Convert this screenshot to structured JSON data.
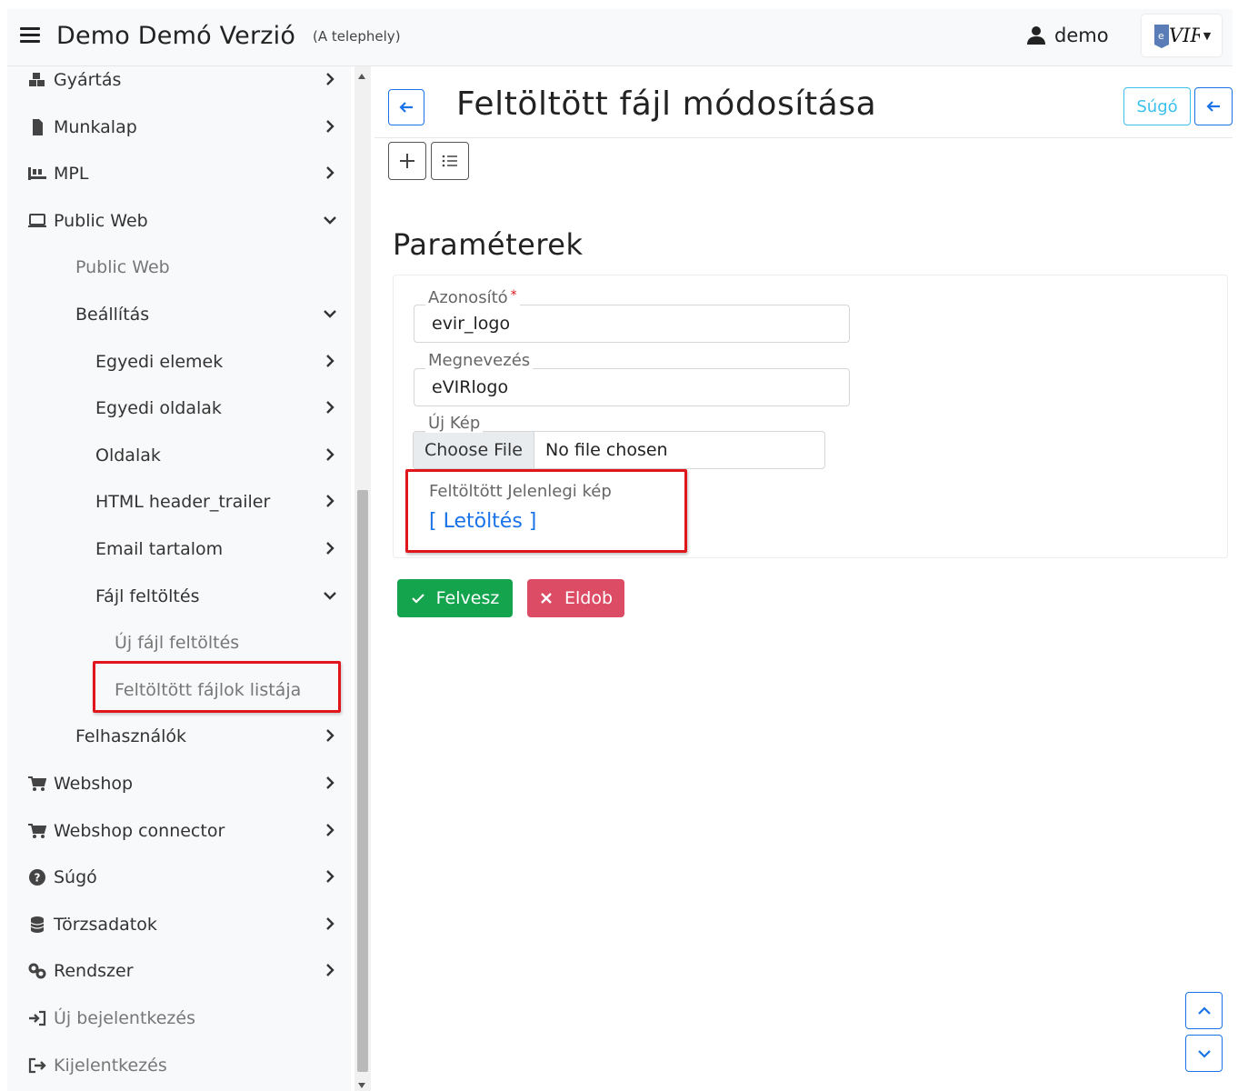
{
  "header": {
    "app_title": "Demo Demó Verzió",
    "site": "(A telephely)",
    "user": "demo",
    "logo_text": "VIR"
  },
  "sidebar": {
    "items": [
      {
        "label": "Gyártás",
        "icon": "cubes-icon",
        "expanded": false
      },
      {
        "label": "Munkalap",
        "icon": "file-icon",
        "expanded": false
      },
      {
        "label": "MPL",
        "icon": "pallet-icon",
        "expanded": false
      },
      {
        "label": "Public Web",
        "icon": "laptop-icon",
        "expanded": true
      },
      {
        "label": "Public Web"
      },
      {
        "label": "Beállítás",
        "expanded": true
      },
      {
        "label": "Egyedi elemek",
        "expanded": false
      },
      {
        "label": "Egyedi oldalak",
        "expanded": false
      },
      {
        "label": "Oldalak",
        "expanded": false
      },
      {
        "label": "HTML header_trailer",
        "expanded": false
      },
      {
        "label": "Email tartalom",
        "expanded": false
      },
      {
        "label": "Fájl feltöltés",
        "expanded": true
      },
      {
        "label": "Új fájl feltöltés"
      },
      {
        "label": "Feltöltött fájlok listája",
        "active": true
      },
      {
        "label": "Felhasználók",
        "expanded": false
      },
      {
        "label": "Webshop",
        "icon": "cart-icon",
        "expanded": false
      },
      {
        "label": "Webshop connector",
        "icon": "cart-icon",
        "expanded": false
      },
      {
        "label": "Súgó",
        "icon": "question-icon",
        "expanded": false
      },
      {
        "label": "Törzsadatok",
        "icon": "database-icon",
        "expanded": false
      },
      {
        "label": "Rendszer",
        "icon": "cogs-icon",
        "expanded": false
      },
      {
        "label": "Új bejelentkezés",
        "icon": "sign-in-icon"
      },
      {
        "label": "Kijelentkezés",
        "icon": "sign-out-icon"
      }
    ]
  },
  "main": {
    "title": "Feltöltött fájl módosítása",
    "help_label": "Súgó",
    "section_title": "Paraméterek",
    "fields": {
      "id_label": "Azonosító",
      "id_required": "*",
      "id_value": "evir_logo",
      "name_label": "Megnevezés",
      "name_value": "eVIRlogo",
      "image_label": "Új Kép",
      "choose_file": "Choose File",
      "no_file": "No file chosen",
      "current_label": "Feltöltött Jelenlegi kép",
      "download": "[ Letöltés ]"
    },
    "actions": {
      "save": "Felvesz",
      "discard": "Eldob"
    }
  },
  "colors": {
    "primary": "#1a73e8",
    "info": "#39c0ed",
    "success": "#14a44d",
    "danger": "#dc4c64",
    "highlight": "#e1161c"
  }
}
